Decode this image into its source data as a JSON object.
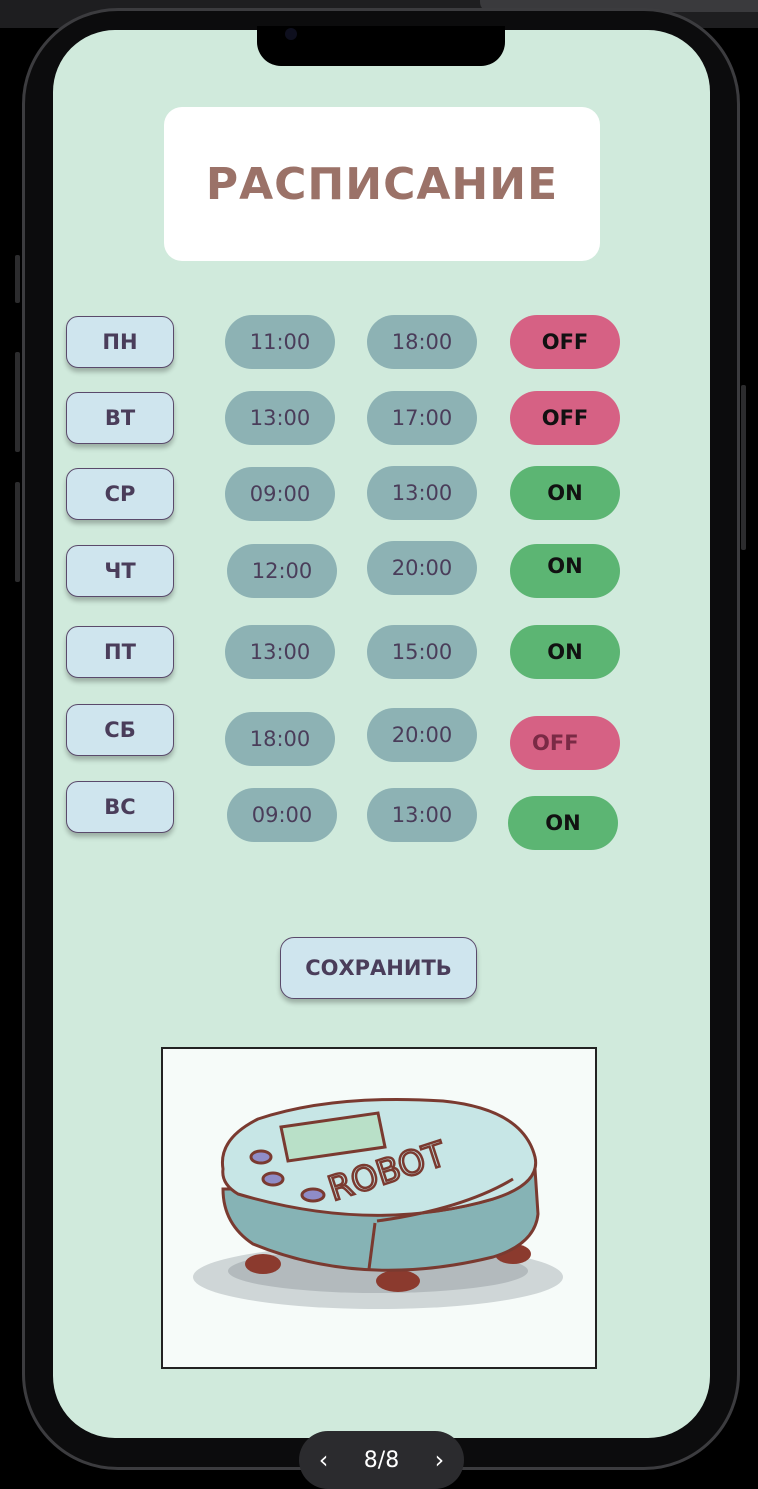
{
  "title": "РАСПИСАНИЕ",
  "schedule": [
    {
      "day": "ПН",
      "start": "11:00",
      "end": "18:00",
      "state": "OFF"
    },
    {
      "day": "ВТ",
      "start": "13:00",
      "end": "17:00",
      "state": "OFF"
    },
    {
      "day": "СР",
      "start": "09:00",
      "end": "13:00",
      "state": "ON"
    },
    {
      "day": "ЧТ",
      "start": "12:00",
      "end": "20:00",
      "state": "ON"
    },
    {
      "day": "ПТ",
      "start": "13:00",
      "end": "15:00",
      "state": "ON"
    },
    {
      "day": "СБ",
      "start": "18:00",
      "end": "20:00",
      "state": "OFF"
    },
    {
      "day": "ВС",
      "start": "09:00",
      "end": "13:00",
      "state": "ON"
    }
  ],
  "save_label": "СОХРАНИТЬ",
  "robot_image_text": "ROBOT",
  "pager": {
    "prev_icon": "chevron-left-icon",
    "label": "8/8",
    "next_icon": "chevron-right-icon"
  },
  "colors": {
    "background": "#d0eadc",
    "title": "#9b7268",
    "day_button": "#cfe5ee",
    "time_pill": "#8db2b4",
    "toggle_on": "#5cb573",
    "toggle_off": "#d66184"
  }
}
